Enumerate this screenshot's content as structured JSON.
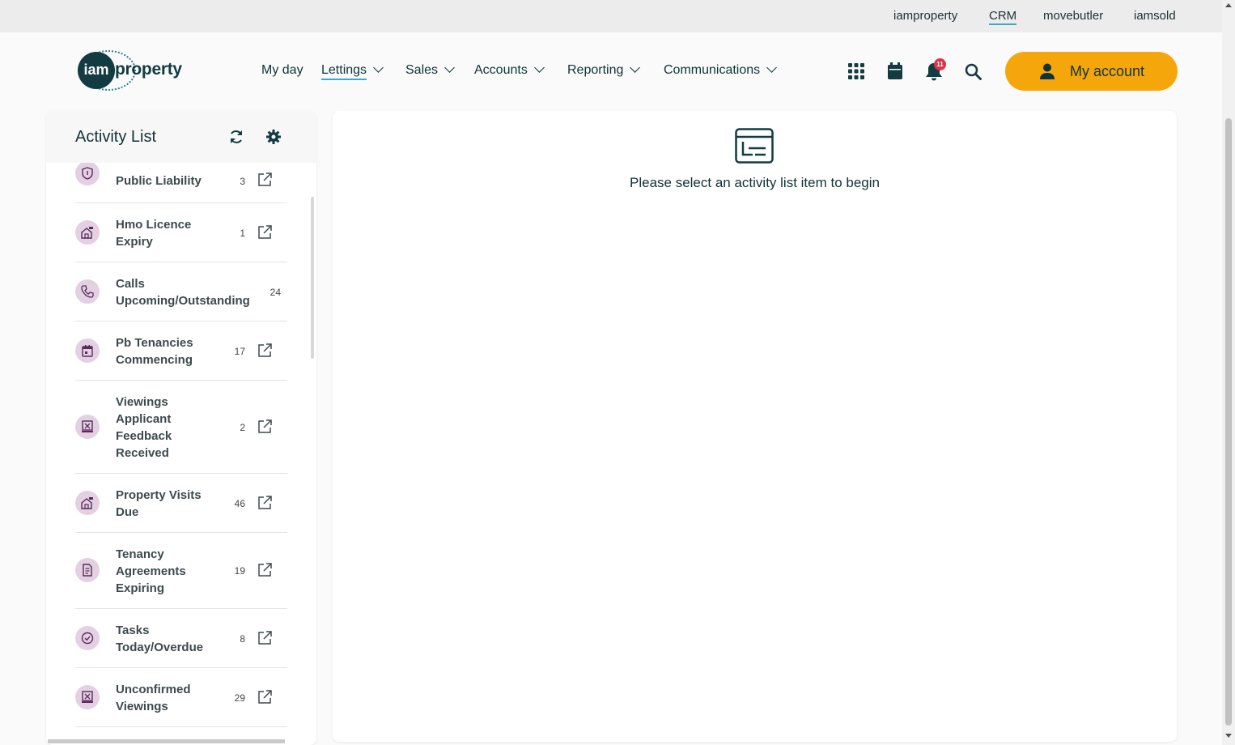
{
  "topbar": {
    "links": [
      "iamproperty",
      "CRM",
      "movebutler",
      "iamsold"
    ],
    "active": "CRM"
  },
  "logo": {
    "mark": "iam",
    "text": "property"
  },
  "nav": {
    "items": [
      {
        "label": "My day",
        "dropdown": false
      },
      {
        "label": "Lettings",
        "dropdown": true,
        "active": true
      },
      {
        "label": "Sales",
        "dropdown": true
      },
      {
        "label": "Accounts",
        "dropdown": true
      },
      {
        "label": "Reporting",
        "dropdown": true
      },
      {
        "label": "Communications",
        "dropdown": true
      }
    ]
  },
  "header": {
    "icons": [
      "apps-grid-icon",
      "calendar-icon",
      "bell-icon",
      "search-icon"
    ],
    "notification_count": "11",
    "account_label": "My account"
  },
  "activity_list": {
    "title": "Activity List",
    "items": [
      {
        "name": "Public Liability",
        "count": "3",
        "icon": "shield-icon",
        "external": true
      },
      {
        "name": "Hmo Licence Expiry",
        "count": "1",
        "icon": "house-flag-icon",
        "external": true
      },
      {
        "name": "Calls Upcoming/Outstanding",
        "count": "24",
        "icon": "phone-icon",
        "external": false
      },
      {
        "name": "Pb Tenancies Commencing",
        "count": "17",
        "icon": "calendar-icon",
        "external": true
      },
      {
        "name": "Viewings Applicant Feedback Received",
        "count": "2",
        "icon": "viewing-icon",
        "external": true
      },
      {
        "name": "Property Visits Due",
        "count": "46",
        "icon": "house-flag-icon",
        "external": true
      },
      {
        "name": "Tenancy Agreements Expiring",
        "count": "19",
        "icon": "document-icon",
        "external": true
      },
      {
        "name": "Tasks Today/Overdue",
        "count": "8",
        "icon": "check-circle-icon",
        "external": true
      },
      {
        "name": "Unconfirmed Viewings",
        "count": "29",
        "icon": "viewing-icon",
        "external": true
      }
    ]
  },
  "main": {
    "empty_message": "Please select an activity list item to begin"
  },
  "colors": {
    "accent": "#f5a60b",
    "brand_dark": "#123b42",
    "link_underline": "#39a9c9",
    "icon_bg": "#e3d1e3",
    "badge": "#d8344a"
  }
}
